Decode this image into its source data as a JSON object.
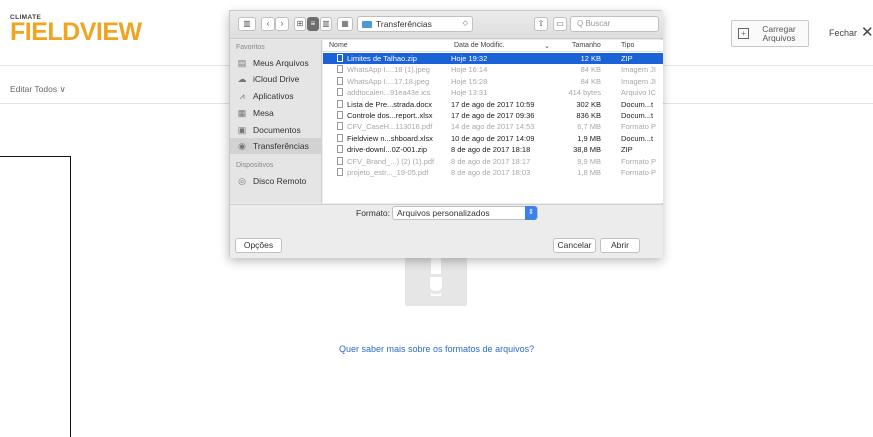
{
  "app": {
    "logo_small": "CLIMATE",
    "logo_big": "FIELDVIEW",
    "upload_button": "Carregar Arquivos",
    "close_button": "Fechar",
    "edit_all": "Editar Todos ∨",
    "learn_link": "Quer saber mais sobre os formatos de arquivos?"
  },
  "dialog": {
    "location": "Transferências",
    "search_placeholder": "Q Buscar",
    "sidebar": {
      "favorites_header": "Favoritos",
      "favorites": [
        {
          "label": "Meus Arquivos",
          "icon": "doc-stack-icon"
        },
        {
          "label": "iCloud Drive",
          "icon": "cloud-icon"
        },
        {
          "label": "Aplicativos",
          "icon": "apps-icon"
        },
        {
          "label": "Mesa",
          "icon": "desktop-icon"
        },
        {
          "label": "Documentos",
          "icon": "documents-icon"
        },
        {
          "label": "Transferências",
          "icon": "downloads-icon"
        }
      ],
      "devices_header": "Dispositivos",
      "devices": [
        {
          "label": "Disco Remoto",
          "icon": "disc-icon"
        }
      ]
    },
    "columns": {
      "name": "Nome",
      "date": "Data de Modific.",
      "size": "Tamanho",
      "kind": "Tipo"
    },
    "files": [
      {
        "name": "Limites de Talhao.zip",
        "date": "Hoje 19:32",
        "size": "12 KB",
        "kind": "ZIP",
        "state": "selected"
      },
      {
        "name": "WhatsApp I....18 (1).jpeg",
        "date": "Hoje 16:14",
        "size": "84 KB",
        "kind": "Imagem JI",
        "state": "dim"
      },
      {
        "name": "WhatsApp I....17.18.jpeg",
        "date": "Hoje 15:28",
        "size": "84 KB",
        "kind": "Imagem JI",
        "state": "dim"
      },
      {
        "name": "addtocalen...91ea43e.ics",
        "date": "Hoje 13:31",
        "size": "414 bytes",
        "kind": "Arquivo IC",
        "state": "dim"
      },
      {
        "name": "Lista de Pre...strada.docx",
        "date": "17 de ago de 2017 10:59",
        "size": "302 KB",
        "kind": "Docum...t",
        "state": "normal"
      },
      {
        "name": "Controle dos...report..xlsx",
        "date": "17 de ago de 2017 09:36",
        "size": "836 KB",
        "kind": "Docum...t",
        "state": "normal"
      },
      {
        "name": "CFV_CaseH...113016.pdf",
        "date": "14 de ago de 2017 14:53",
        "size": "6,7 MB",
        "kind": "Formato P",
        "state": "dim"
      },
      {
        "name": "Fieldview n...shboard.xlsx",
        "date": "10 de ago de 2017 14:09",
        "size": "1,9 MB",
        "kind": "Docum...t",
        "state": "normal"
      },
      {
        "name": "drive-downl...0Z-001.zip",
        "date": "8 de ago de 2017 18:18",
        "size": "38,8 MB",
        "kind": "ZIP",
        "state": "normal"
      },
      {
        "name": "CFV_Brand_...) (2) (1).pdf",
        "date": "8 de ago de 2017 18:17",
        "size": "9,9 MB",
        "kind": "Formato P",
        "state": "dim"
      },
      {
        "name": "projeto_estr..._19-05.pdf",
        "date": "8 de ago de 2017 18:03",
        "size": "1,8 MB",
        "kind": "Formato P",
        "state": "dim"
      }
    ],
    "format_label": "Formato:",
    "format_value": "Arquivos personalizados",
    "options_button": "Opções",
    "cancel_button": "Cancelar",
    "open_button": "Abrir"
  },
  "colors": {
    "accent": "#1b62d6",
    "brand": "#f0a422",
    "link": "#2b6cc2"
  }
}
